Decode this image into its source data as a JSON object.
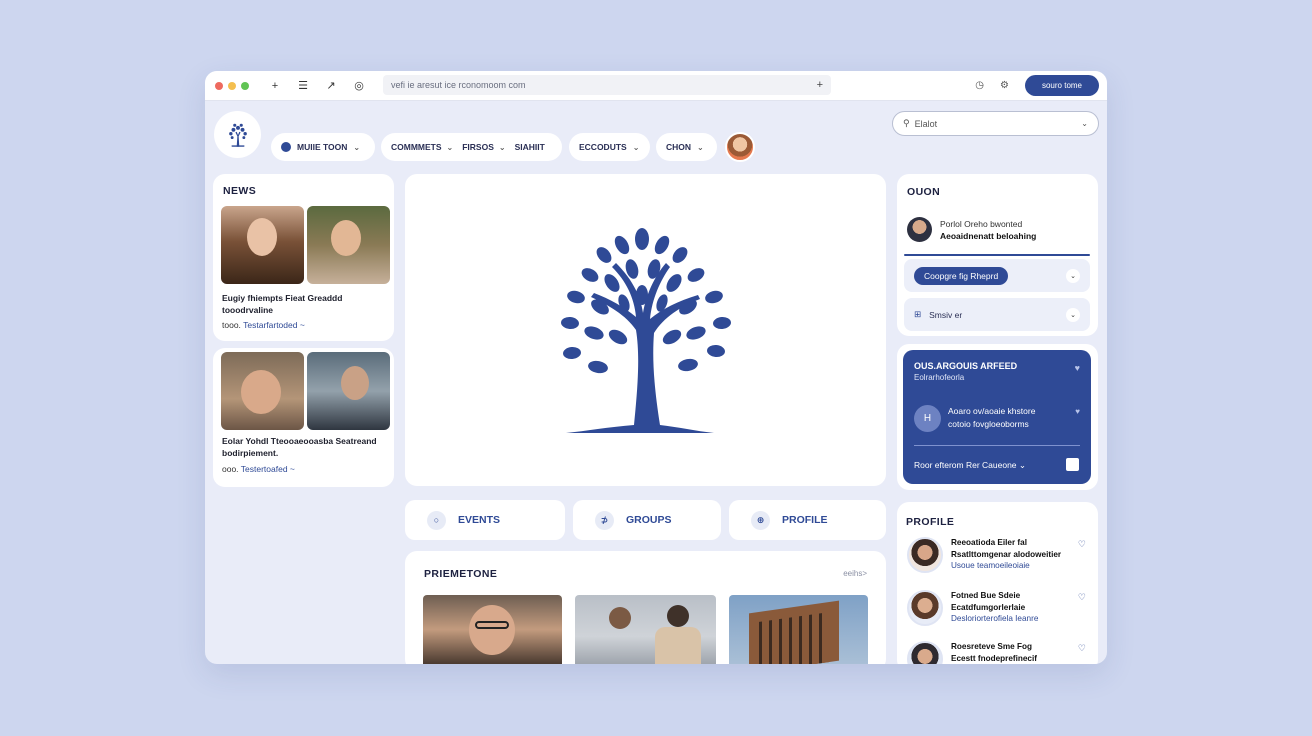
{
  "browser": {
    "url": "vefi ie aresut ice rconomoom com",
    "plus": "+",
    "signin_label": "souro tome",
    "toolbar_glyphs": {
      "new_tab": "+",
      "menu": "☰",
      "back": "↗",
      "globe": "◎",
      "clock": "◷",
      "settings": "⚙"
    }
  },
  "nav": {
    "pills": [
      {
        "label": "MUIIE TOON",
        "chev": "⌄"
      },
      {
        "label": "COMMMETS",
        "chev": "⌄"
      },
      {
        "label": "FIRSOS",
        "chev": "⌄"
      },
      {
        "label": "SIAHIIT",
        "chev": ""
      },
      {
        "label": "ECCODUTS",
        "chev": "⌄"
      },
      {
        "label": "CHON",
        "chev": "⌄"
      }
    ],
    "search_placeholder": "Elalot",
    "search_chev": "⌄"
  },
  "news": {
    "title": "NEWS",
    "items": [
      {
        "headline": "Eugiy fhiempts Fieat Greaddd tooodrvaline",
        "meta_prefix": "tooo.",
        "meta_link": "Testarfartoded",
        "meta_suffix": "~"
      },
      {
        "headline": "Eolar Yohdl Tteooaeooasba Seatreand bodirpiement.",
        "meta_prefix": "ooo.",
        "meta_link": "Testertoafed",
        "meta_suffix": "~"
      }
    ]
  },
  "actions": [
    {
      "label": "EVENTS",
      "icon": "○"
    },
    {
      "label": "GROUPS",
      "icon": "⊅"
    },
    {
      "label": "PROFILE",
      "icon": "⊕"
    }
  ],
  "prometone": {
    "title": "PRIEMETONE",
    "more": "eeihs>"
  },
  "right": {
    "title": "OUON",
    "person": {
      "l1": "Porlol Oreho bwonted",
      "l2": "Aeoaidnenatt beloahing"
    },
    "select_pill": "Coopgre fig Rheprd",
    "select_chev": "⌄",
    "row2_icon": "⊞",
    "row2_label": "Smsiv er",
    "row2_chev": "⌄"
  },
  "promo": {
    "title": "OUS.ARGOUIS ARFEED",
    "subtitle": "Eolrarhofeorla",
    "avatar_letter": "H",
    "line1": "Aoaro ov/aoaie khstore",
    "line2": "cotoio fovgloeoborms",
    "footer": "Roor efterom Rer Caueone",
    "footer_chev": "⌄",
    "heart": "♥"
  },
  "profile": {
    "title": "PROFILE",
    "items": [
      {
        "l1": "Reeoatioda Eiler fal",
        "l2": "Rsatlttomgenar alodoweitier",
        "l3": "Usoue teamoeileoiaie"
      },
      {
        "l1": "Fotned Bue Sdeie",
        "l2": "Ecatdfumgorlerlaie",
        "l3": "Desloriorterofiela Ieanre"
      },
      {
        "l1": "Roesreteve Sme Fog",
        "l2": "Ecestt fnodeprefinecif",
        "l3": ""
      }
    ],
    "heart": "♡"
  },
  "colors": {
    "accent": "#2f4a96",
    "background": "#cdd6ef",
    "window": "#e9ecf8"
  }
}
